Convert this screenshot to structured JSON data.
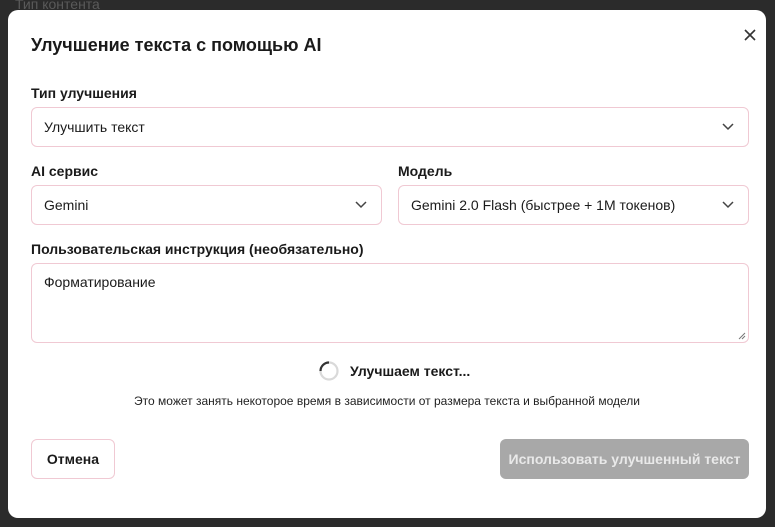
{
  "backdrop": {
    "label": "Тип контента"
  },
  "dialog": {
    "title": "Улучшение текста с помощью AI",
    "close_icon": "close-icon"
  },
  "improvement_type": {
    "label": "Тип улучшения",
    "value": "Улучшить текст"
  },
  "ai_service": {
    "label": "AI сервис",
    "value": "Gemini"
  },
  "model": {
    "label": "Модель",
    "value": "Gemini 2.0 Flash (быстрее + 1M токенов)"
  },
  "custom_instruction": {
    "label": "Пользовательская инструкция (необязательно)",
    "value": "Форматирование"
  },
  "status": {
    "loading_text": "Улучшаем текст...",
    "hint": "Это может занять некоторое время в зависимости от размера текста и выбранной модели"
  },
  "actions": {
    "cancel_label": "Отмена",
    "use_label": "Использовать улучшенный текст"
  },
  "colors": {
    "border_accent": "#f0c9d3",
    "disabled_button": "#a8a8a8"
  }
}
